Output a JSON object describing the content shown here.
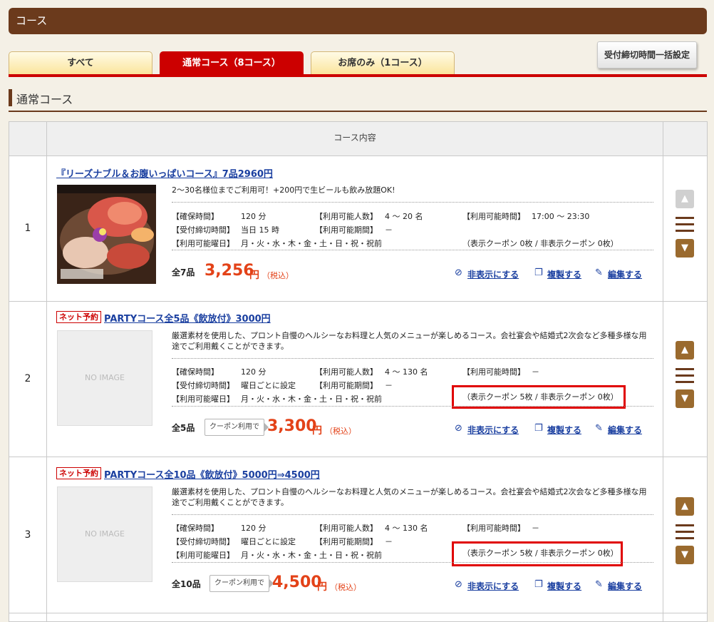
{
  "title": "コース",
  "tabs": [
    {
      "label": "すべて"
    },
    {
      "label": "通常コース（8コース）"
    },
    {
      "label": "お席のみ（1コース）"
    }
  ],
  "bulk_button": "受付締切時間一括設定",
  "section_title": "通常コース",
  "table": {
    "header": "コース内容"
  },
  "labels": {
    "keep_time": "【確保時間】",
    "cutoff": "【受付締切時間】",
    "days": "【利用可能曜日】",
    "people": "【利用可能人数】",
    "period": "【利用可能期間】",
    "hours": "【利用可能時間】",
    "yen": "円",
    "tax": "（税込）",
    "hide": "非表示にする",
    "copy": "複製する",
    "edit": "編集する",
    "no_image": "NO IMAGE",
    "net_badge": "ネット予約",
    "coupon_tag": "クーポン利用で"
  },
  "courses": [
    {
      "num": "1",
      "title": "『リーズナブル＆お腹いっぱいコース』7品2960円",
      "desc": "2～30名様位までご利用可！+200円で生ビールも飲み放題OK!",
      "keep_time": "120 分",
      "cutoff": "当日 15 時",
      "days": "月・火・水・木・金・土・日・祝・祝前",
      "people": "4 ～ 20 名",
      "period": "－",
      "hours": "17:00 ～ 23:30",
      "coupons": "（表示クーポン 0枚 / 非表示クーポン 0枚）",
      "total": "全7品",
      "price": "3,256"
    },
    {
      "num": "2",
      "title": "PARTYコース全5品《飲放付》3000円",
      "desc": "厳選素材を使用した、プロント自慢のヘルシーなお料理と人気のメニューが楽しめるコース。会社宴会や結婚式2次会など多種多様な用途でご利用戴くことができます。",
      "keep_time": "120 分",
      "cutoff": "曜日ごとに設定",
      "days": "月・火・水・木・金・土・日・祝・祝前",
      "people": "4 ～ 130 名",
      "period": "－",
      "hours": "－",
      "coupons": "（表示クーポン 5枚 / 非表示クーポン 0枚）",
      "total": "全5品",
      "price": "3,300"
    },
    {
      "num": "3",
      "title": "PARTYコース全10品《飲放付》5000円⇒4500円",
      "desc": "厳選素材を使用した、プロント自慢のヘルシーなお料理と人気のメニューが楽しめるコース。会社宴会や結婚式2次会など多種多様な用途でご利用戴くことができます。",
      "keep_time": "120 分",
      "cutoff": "曜日ごとに設定",
      "days": "月・火・水・木・金・土・日・祝・祝前",
      "people": "4 ～ 130 名",
      "period": "－",
      "hours": "－",
      "coupons": "（表示クーポン 5枚 / 非表示クーポン 0枚）",
      "total": "全10品",
      "price": "4,500"
    }
  ]
}
